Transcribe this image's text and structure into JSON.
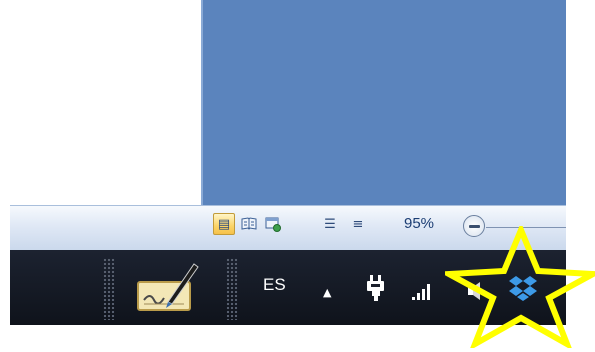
{
  "status_bar": {
    "views": [
      {
        "name": "print-layout",
        "glyph": "▤",
        "active": true
      },
      {
        "name": "full-screen-reading",
        "glyph": "📖",
        "active": false
      },
      {
        "name": "web-layout",
        "glyph": "▣",
        "active": false
      },
      {
        "name": "outline",
        "glyph": "☰",
        "active": false
      },
      {
        "name": "draft",
        "glyph": "≡",
        "active": false
      }
    ],
    "zoom_level": "95%"
  },
  "taskbar": {
    "language": "ES",
    "tray_arrow": "▲",
    "signal_glyph": ".ıll"
  },
  "colors": {
    "document_blue": "#5b84bd",
    "taskbar_dark": "#141925",
    "highlight_star": "#ffff00",
    "active_view": "#fbd468"
  }
}
